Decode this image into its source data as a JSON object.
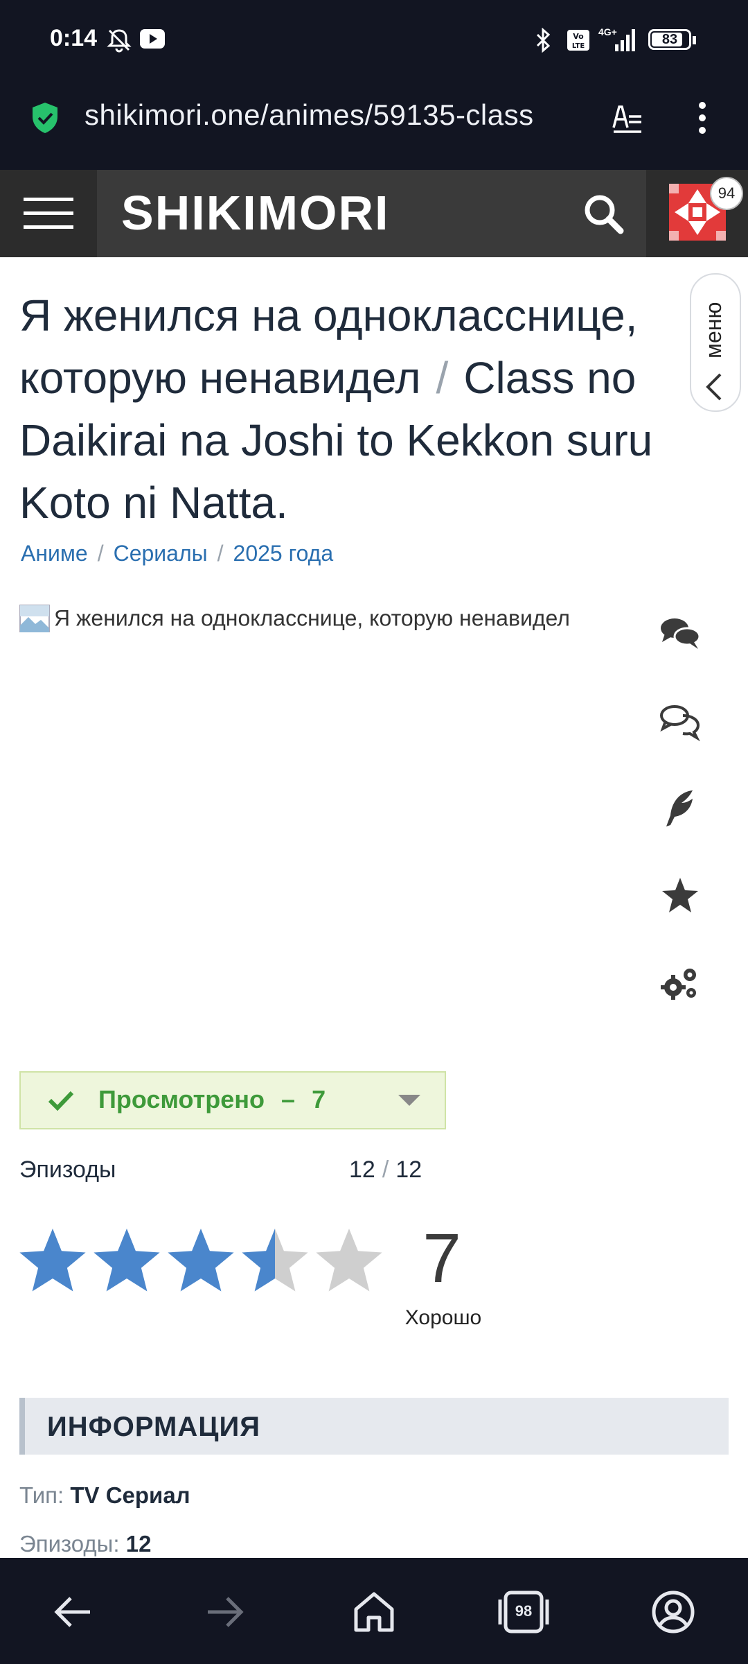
{
  "status_bar": {
    "time": "0:14",
    "battery": "83",
    "network": "4G+"
  },
  "browser": {
    "url": "shikimori.one/animes/59135-class"
  },
  "site": {
    "logo": "SHIKIMORI",
    "notification_count": "94"
  },
  "side_tab": {
    "label": "меню"
  },
  "anime": {
    "title_ru_line1": "Я женился на однокласснице,",
    "title_ru_line2": "которую ненавидел",
    "title_sep": "/",
    "title_en_line2": "Class no",
    "title_en_line3": "Daikirai na Joshi to Kekkon suru",
    "title_en_line4": "Koto ni Natta.",
    "poster_alt": "Я женился на однокласснице, которую ненавидел"
  },
  "breadcrumbs": [
    "Аниме",
    "Сериалы",
    "2025 года"
  ],
  "side_icons": [
    "comments-icon",
    "discussion-icon",
    "review-feather-icon",
    "favorite-star-icon",
    "settings-gears-icon"
  ],
  "watch_status": {
    "label": "Просмотрено",
    "dash": "–",
    "score": "7"
  },
  "episodes": {
    "label": "Эпизоды",
    "watched": "12",
    "sep": "/",
    "total": "12"
  },
  "rating": {
    "score": "7",
    "max_stars": 5,
    "filled_stars": 3.5,
    "word": "Хорошо"
  },
  "info": {
    "heading": "ИНФОРМАЦИЯ",
    "type_label": "Тип:",
    "type_value": "TV Сериал",
    "episodes_label": "Эпизоды:",
    "episodes_value": "12"
  },
  "bottom_nav": {
    "tabs_count": "98"
  },
  "colors": {
    "header_bg": "#3a3a3a",
    "status_green": "#3e9a3a",
    "star_blue": "#4a86cc",
    "star_gray": "#cfcfcf",
    "link_blue": "#2a6fb0"
  }
}
